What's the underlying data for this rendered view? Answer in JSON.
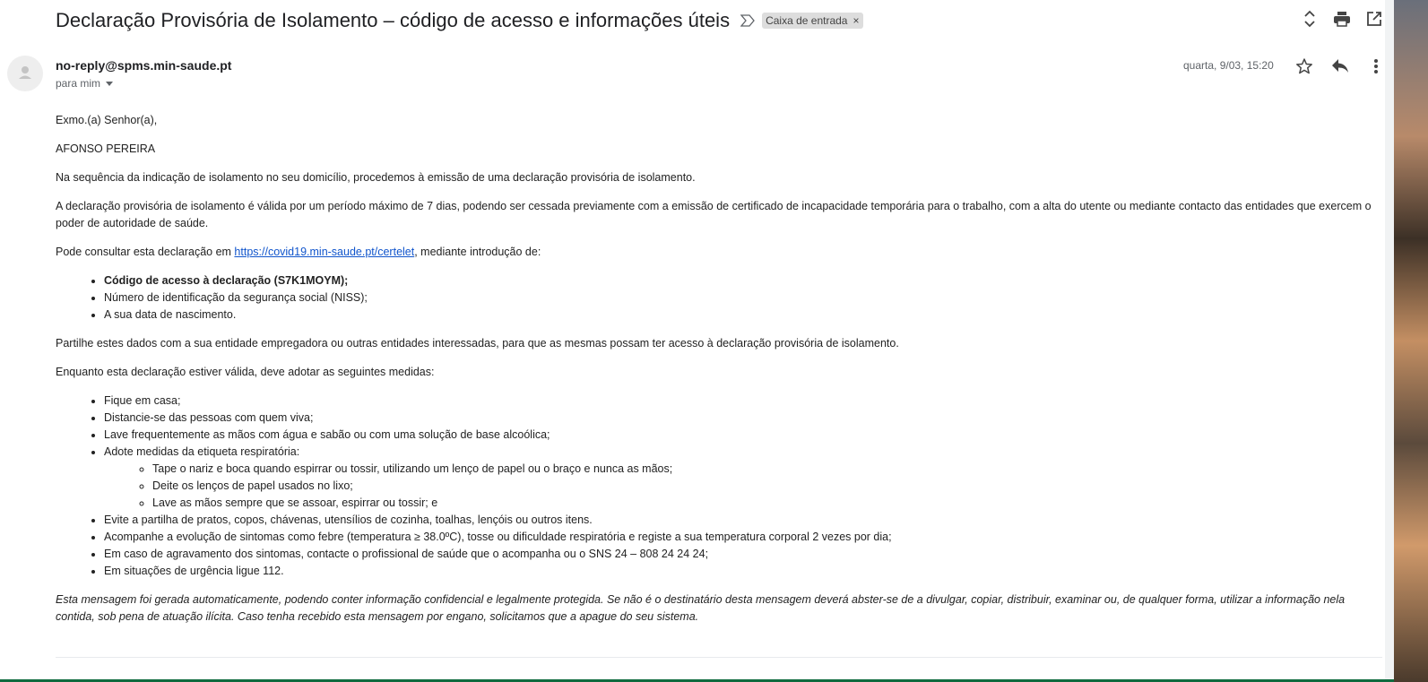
{
  "email": {
    "subject": "Declaração Provisória de Isolamento – código de acesso e informações úteis",
    "label": "Caixa de entrada",
    "label_remove": "×",
    "sender": "no-reply@spms.min-saude.pt",
    "to": "para mim",
    "date": "quarta, 9/03, 15:20"
  },
  "icons": {
    "important": "important-marker-icon",
    "expand": "expand-collapse-icon",
    "print": "print-icon",
    "open_new_window": "open-in-new-window-icon",
    "star": "star-icon",
    "reply": "reply-icon",
    "more": "more-vert-icon",
    "avatar": "avatar-icon"
  },
  "body": {
    "greeting": "Exmo.(a) Senhor(a),",
    "name": "AFONSO PEREIRA",
    "p1": "Na sequência da indicação de isolamento no seu domicílio, procedemos à emissão de uma declaração provisória de isolamento.",
    "p2": "A declaração provisória de isolamento é válida por um período máximo de 7 dias, podendo ser cessada previamente com a emissão de certificado de incapacidade temporária para o trabalho, com a alta do utente ou mediante contacto das entidades que exercem o poder de autoridade de saúde.",
    "p3_before": "Pode consultar esta declaração em ",
    "p3_link": "https://covid19.min-saude.pt/certelet",
    "p3_after": ", mediante introdução de:",
    "access_list": [
      "Código de acesso à declaração (S7K1MOYM);",
      "Número de identificação da segurança social (NISS);",
      "A sua data de nascimento."
    ],
    "p4": "Partilhe estes dados com a sua entidade empregadora ou outras entidades interessadas, para que as mesmas possam ter acesso à declaração provisória de isolamento.",
    "p5": "Enquanto esta declaração estiver válida, deve adotar as seguintes medidas:",
    "measures": [
      "Fique em casa;",
      "Distancie-se das pessoas com quem viva;",
      "Lave frequentemente as mãos com água e sabão ou com uma solução de base alcoólica;",
      "Adote medidas da etiqueta respiratória:",
      "Evite a partilha de pratos, copos, chávenas, utensílios de cozinha, toalhas, lençóis ou outros itens.",
      "Acompanhe a evolução de sintomas como febre (temperatura ≥ 38.0ºC), tosse ou dificuldade respiratória e registe a sua temperatura corporal 2 vezes por dia;",
      "Em caso de agravamento dos sintomas, contacte o profissional de saúde que o acompanha ou o SNS 24 – 808 24 24 24;",
      "Em situações de urgência ligue 112."
    ],
    "respiratory": [
      "Tape o nariz e boca quando espirrar ou tossir, utilizando um lenço de papel ou o braço e nunca as mãos;",
      "Deite os lenços de papel usados no lixo;",
      "Lave as mãos sempre que se assoar, espirrar ou tossir; e"
    ],
    "disclaimer": "Esta mensagem foi gerada automaticamente, podendo conter informação confidencial e legalmente protegida. Se não é o destinatário desta mensagem deverá abster-se de a divulgar, copiar, distribuir, examinar ou, de qualquer forma, utilizar a informação nela contida, sob pena de atuação ilícita. Caso tenha recebido esta mensagem por engano, solicitamos que a apague do seu sistema."
  }
}
